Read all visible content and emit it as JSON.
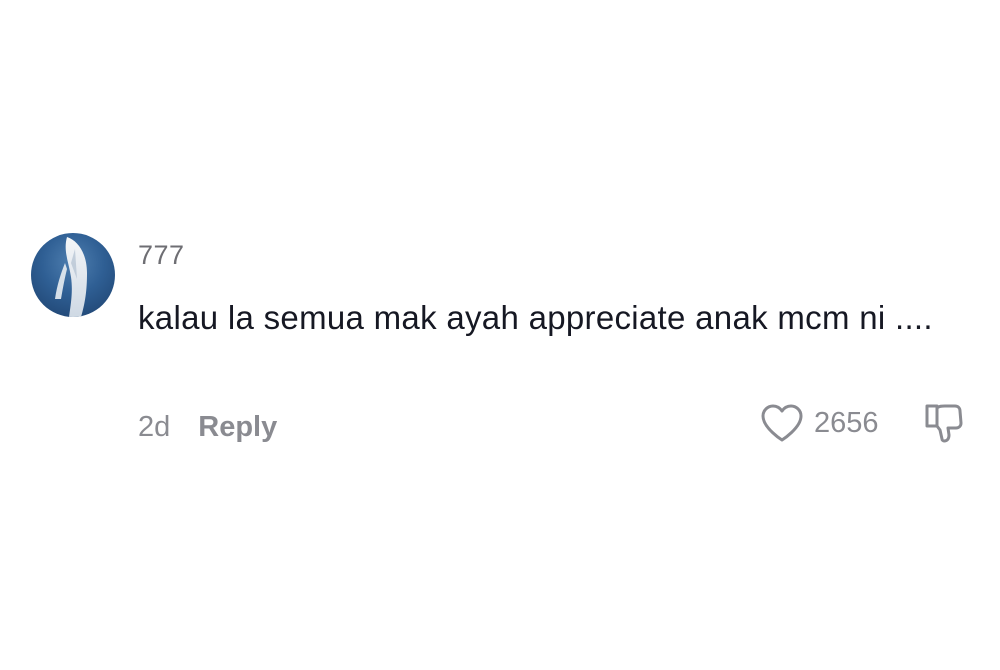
{
  "comment": {
    "username": "777",
    "text": "kalau la semua mak ayah appreciate anak mcm ni ....",
    "time": "2d",
    "reply_label": "Reply",
    "like_count": "2656",
    "avatar_icon": "profile-avatar",
    "like_icon": "heart-outline-icon",
    "dislike_icon": "thumbs-down-outline-icon"
  }
}
